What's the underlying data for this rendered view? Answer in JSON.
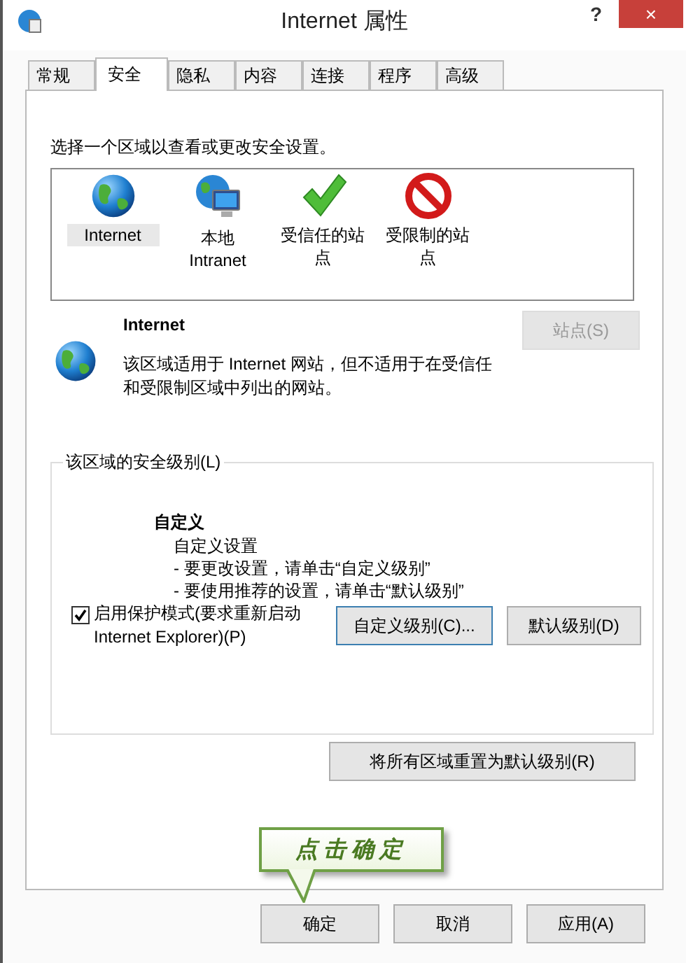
{
  "window": {
    "title": "Internet 属性",
    "help": "?",
    "close": "×"
  },
  "tabs": [
    {
      "label": "常规",
      "selected": false
    },
    {
      "label": "安全",
      "selected": true
    },
    {
      "label": "隐私",
      "selected": false
    },
    {
      "label": "内容",
      "selected": false
    },
    {
      "label": "连接",
      "selected": false
    },
    {
      "label": "程序",
      "selected": false
    },
    {
      "label": "高级",
      "selected": false
    }
  ],
  "zone_prompt": "选择一个区域以查看或更改安全设置。",
  "zones": [
    {
      "label": "Internet",
      "kind": "globe",
      "selected": true
    },
    {
      "label": "本地 Intranet",
      "kind": "intranet",
      "selected": false
    },
    {
      "label": "受信任的站点",
      "kind": "trusted",
      "selected": false
    },
    {
      "label": "受限制的站点",
      "kind": "restricted",
      "selected": false
    }
  ],
  "zone_info": {
    "name": "Internet",
    "description": "该区域适用于 Internet 网站，但不适用于在受信任和受限制区域中列出的网站。",
    "sites_button": {
      "label": "站点(S)",
      "disabled": true
    }
  },
  "security_level": {
    "legend": "该区域的安全级别(L)",
    "level_name": "自定义",
    "details": [
      "自定义设置",
      "- 要更改设置，请单击“自定义级别”",
      "- 要使用推荐的设置，请单击“默认级别”"
    ]
  },
  "protected_mode": {
    "label": "启用保护模式(要求重新启动 Internet Explorer)(P)",
    "checked": true
  },
  "level_buttons": [
    {
      "label": "自定义级别(C)...",
      "focused": true
    },
    {
      "label": "默认级别(D)",
      "focused": false
    }
  ],
  "reset_button": "将所有区域重置为默认级别(R)",
  "callout": "点击确定",
  "dialog_buttons": [
    "确定",
    "取消",
    "应用(A)"
  ]
}
